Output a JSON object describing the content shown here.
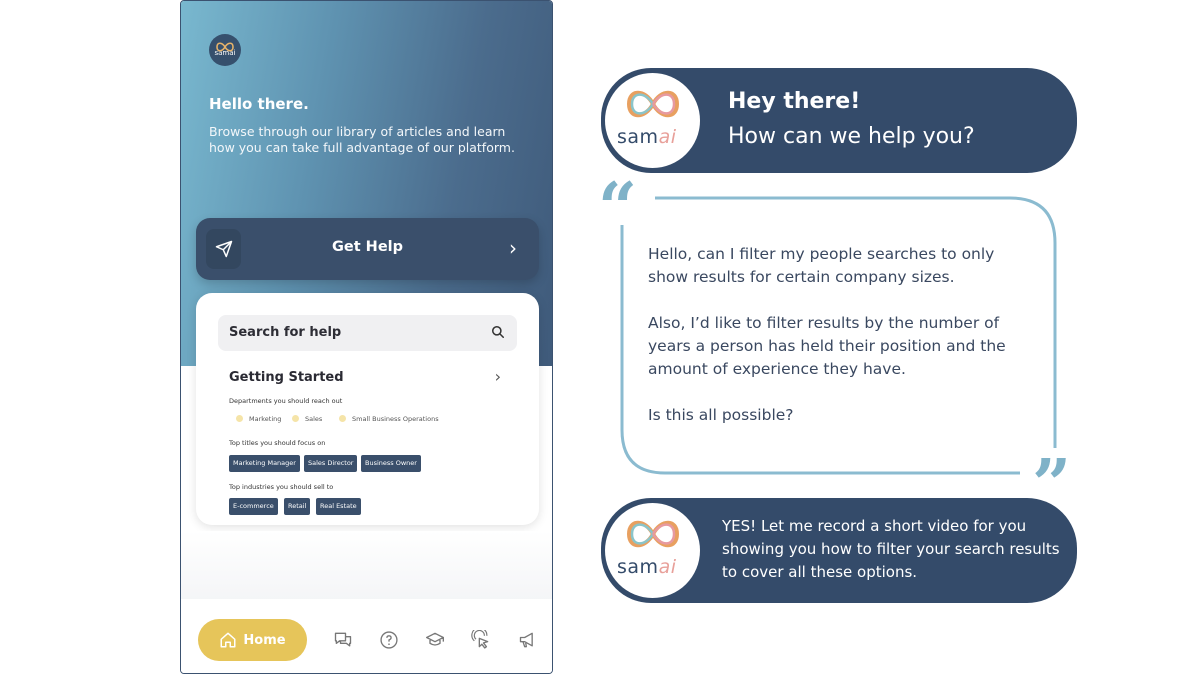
{
  "colors": {
    "navy": "#344b6a",
    "accent_yellow": "#e6c55a",
    "quote_blue": "#7fb2c8"
  },
  "phone": {
    "logo_text": "samai",
    "greeting": "Hello there.",
    "intro": "Browse through our library of articles and learn how you can take full advantage of our platform.",
    "get_help": {
      "label": "Get Help",
      "icon": "send-icon"
    },
    "search": {
      "placeholder": "Search for help",
      "icon": "search-icon"
    },
    "getting_started": {
      "title": "Getting Started",
      "departments_label": "Departments you should reach out",
      "departments": [
        "Marketing",
        "Sales",
        "Small Business Operations"
      ],
      "titles_label": "Top titles you should focus on",
      "titles": [
        "Marketing Manager",
        "Sales Director",
        "Business Owner"
      ],
      "industries_label": "Top industries you should sell to",
      "industries": [
        "E-commerce",
        "Retail",
        "Real Estate"
      ]
    },
    "nav": {
      "home_label": "Home",
      "icons": [
        "chat-icon",
        "help-icon",
        "graduation-cap-icon",
        "pointer-click-icon",
        "megaphone-icon"
      ]
    }
  },
  "chat": {
    "greeting_title": "Hey there!",
    "greeting_question": "How can we help you?",
    "user_message": [
      "Hello, can I filter my people searches to only show results for certain company sizes.",
      "Also, I’d like to filter results by the number of years a person has held their position and the amount of experience they have.",
      "Is this all possible?"
    ],
    "bot_reply": "YES! Let me record a short video for you showing you how to filter your search results to cover all these options.",
    "avatar_word_sam": "sam",
    "avatar_word_ai": "ai"
  }
}
